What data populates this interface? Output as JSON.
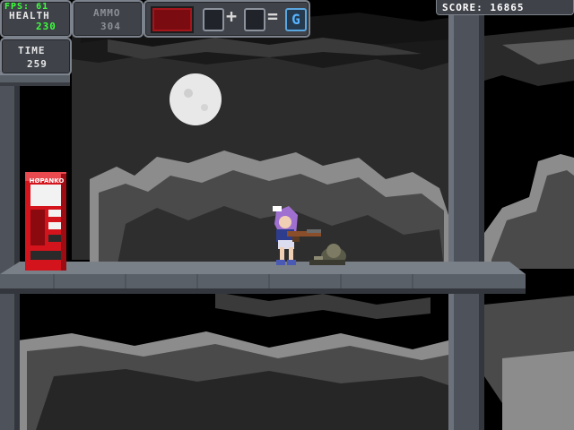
{
  "hud": {
    "fps": "FPS: 61",
    "health_label": "HEALTH",
    "health_value": "230",
    "ammo_label": "AMMO",
    "ammo_value": "304",
    "time_label": "TIME",
    "time_value": "259",
    "score": "SCORE: 16865",
    "plus": "+",
    "equals": "=",
    "combo_result": "G"
  },
  "scene": {
    "vending_label": "HØPANKO"
  },
  "colors": {
    "hud_green": "#3cff3c",
    "hud_panel": "#3f4249",
    "platform": "#5a6068",
    "cloud_light": "#8c8c8c",
    "cloud_dark": "#4a4a4a",
    "vending_red": "#d3141c",
    "moon": "#e8e8e8"
  }
}
